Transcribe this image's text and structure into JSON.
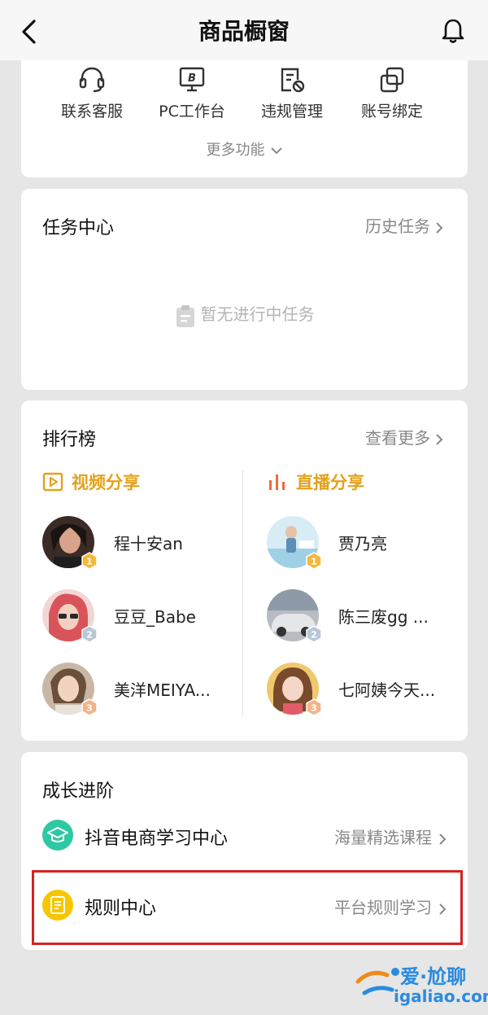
{
  "header": {
    "title": "商品橱窗"
  },
  "functions": {
    "items": [
      {
        "label": "联系客服",
        "icon": "headset-icon"
      },
      {
        "label": "PC工作台",
        "icon": "monitor-icon"
      },
      {
        "label": "违规管理",
        "icon": "violation-icon"
      },
      {
        "label": "账号绑定",
        "icon": "link-icon"
      }
    ],
    "more_label": "更多功能"
  },
  "tasks": {
    "title": "任务中心",
    "history_label": "历史任务",
    "empty_text": "暂无进行中任务"
  },
  "ranking": {
    "title": "排行榜",
    "more_label": "查看更多",
    "video": {
      "title": "视频分享",
      "entries": [
        {
          "rank": "1",
          "name": "程十安an"
        },
        {
          "rank": "2",
          "name": "豆豆_Babe"
        },
        {
          "rank": "3",
          "name": "美洋MEIYA..."
        }
      ]
    },
    "live": {
      "title": "直播分享",
      "entries": [
        {
          "rank": "1",
          "name": "贾乃亮"
        },
        {
          "rank": "2",
          "name": "陈三废gg ..."
        },
        {
          "rank": "3",
          "name": "七阿姨今天..."
        }
      ]
    }
  },
  "growth": {
    "title": "成长进阶",
    "items": [
      {
        "name": "抖音电商学习中心",
        "hint": "海量精选课程"
      },
      {
        "name": "规则中心",
        "hint": "平台规则学习"
      }
    ]
  },
  "watermark": {
    "line1": "爱·尬聊",
    "line2": "igaliao.com"
  },
  "colors": {
    "accent_gold": "#e3a21a",
    "live_orange": "#f06a3a",
    "teal": "#2dc9a2",
    "yellow": "#f7c600",
    "highlight_red": "#d42222",
    "watermark_blue": "#2a8be0"
  }
}
